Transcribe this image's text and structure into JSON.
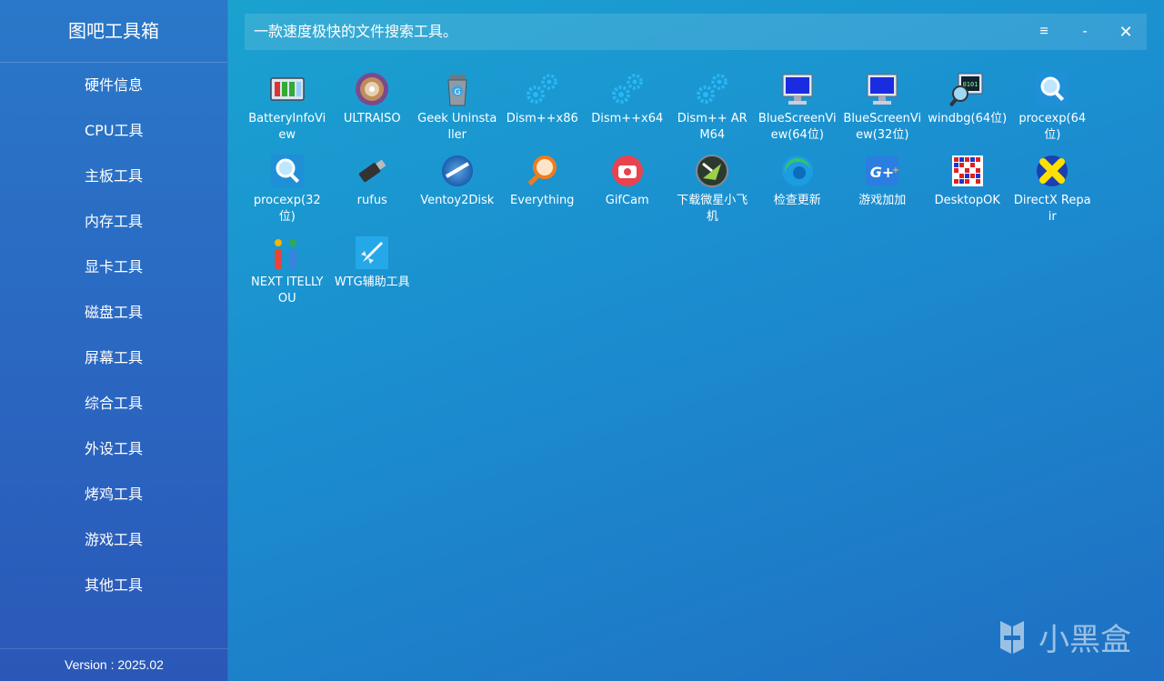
{
  "app": {
    "title": "图吧工具箱",
    "version": "Version : 2025.02"
  },
  "sidebar": {
    "items": [
      {
        "label": "硬件信息"
      },
      {
        "label": "CPU工具"
      },
      {
        "label": "主板工具"
      },
      {
        "label": "内存工具"
      },
      {
        "label": "显卡工具"
      },
      {
        "label": "磁盘工具"
      },
      {
        "label": "屏幕工具"
      },
      {
        "label": "综合工具"
      },
      {
        "label": "外设工具"
      },
      {
        "label": "烤鸡工具"
      },
      {
        "label": "游戏工具"
      },
      {
        "label": "其他工具"
      }
    ]
  },
  "titlebar": {
    "tagline": "一款速度极快的文件搜索工具。",
    "menu": "≡",
    "minimize": "-",
    "close": "✕"
  },
  "tools": [
    {
      "label": "BatteryInfoView",
      "icon": "battery-icon"
    },
    {
      "label": "ULTRAISO",
      "icon": "disc-icon"
    },
    {
      "label": "Geek Uninstaller",
      "icon": "trash-icon"
    },
    {
      "label": "Dism++x86",
      "icon": "gears-icon"
    },
    {
      "label": "Dism++x64",
      "icon": "gears-icon"
    },
    {
      "label": "Dism++ ARM64",
      "icon": "gears-icon"
    },
    {
      "label": "BlueScreenView(64位)",
      "icon": "monitor-icon"
    },
    {
      "label": "BlueScreenView(32位)",
      "icon": "monitor-icon"
    },
    {
      "label": "windbg(64位)",
      "icon": "debugger-icon"
    },
    {
      "label": "procexp(64位)",
      "icon": "magnifier-icon"
    },
    {
      "label": "procexp(32位)",
      "icon": "magnifier-icon"
    },
    {
      "label": "rufus",
      "icon": "usb-drive-icon"
    },
    {
      "label": "Ventoy2Disk",
      "icon": "ventoy-icon"
    },
    {
      "label": "Everything",
      "icon": "search-icon"
    },
    {
      "label": "GifCam",
      "icon": "camera-icon"
    },
    {
      "label": "下载微星小飞机",
      "icon": "afterburner-icon"
    },
    {
      "label": "检查更新",
      "icon": "edge-icon"
    },
    {
      "label": "游戏加加",
      "icon": "game-plus-icon"
    },
    {
      "label": "DesktopOK",
      "icon": "grid-icon"
    },
    {
      "label": "DirectX Repair",
      "icon": "directx-icon"
    },
    {
      "label": "NEXT ITELLYOU",
      "icon": "itellyou-icon"
    },
    {
      "label": "WTG辅助工具",
      "icon": "rocket-icon"
    }
  ],
  "watermark": {
    "text": "小黑盒"
  }
}
